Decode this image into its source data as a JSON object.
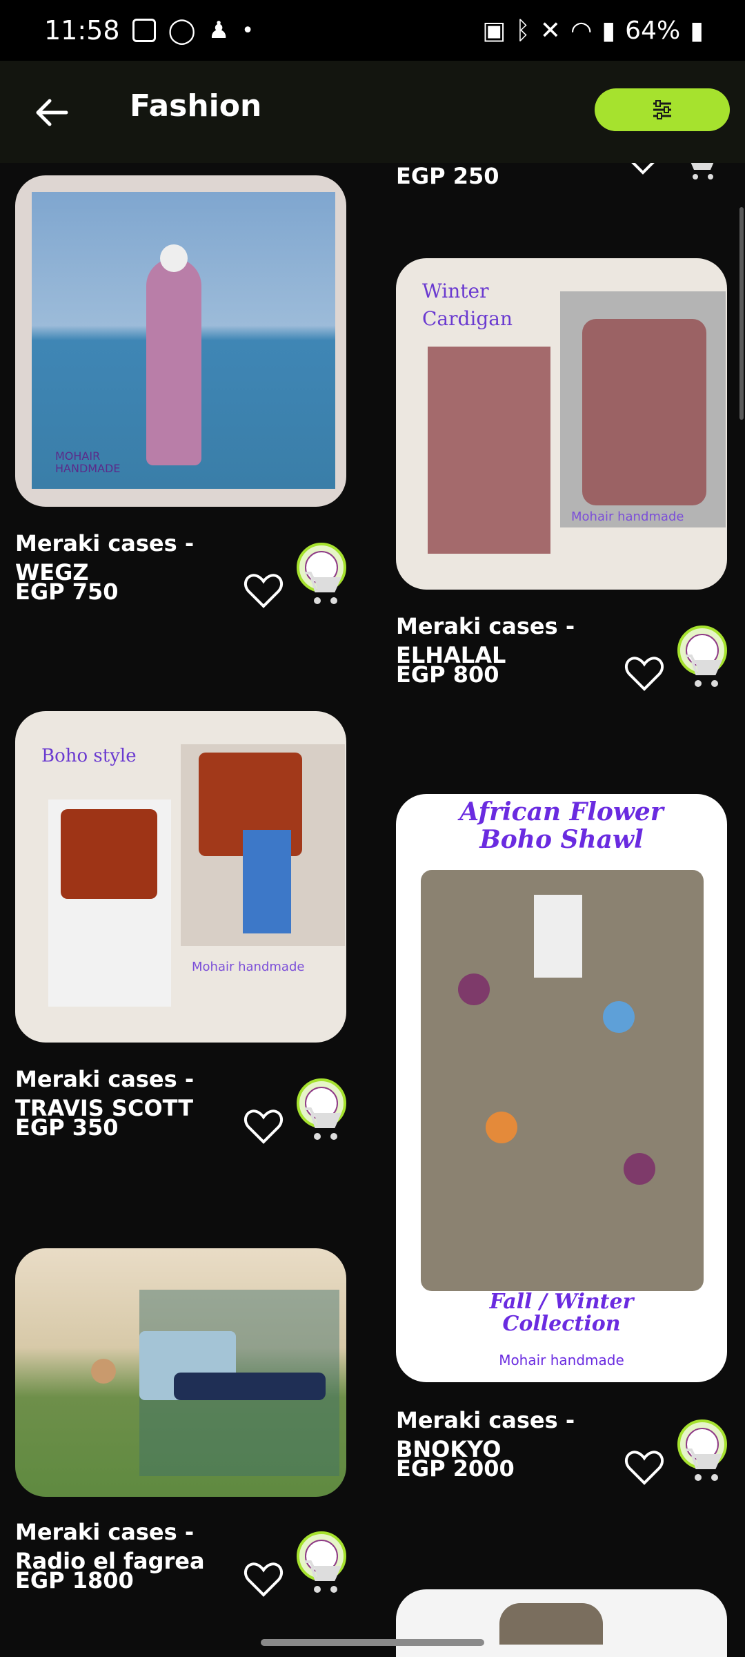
{
  "status_bar": {
    "time": "11:58",
    "battery": "64%"
  },
  "header": {
    "title": "Fashion"
  },
  "partial_top_right": {
    "price": "EGP 250"
  },
  "products": [
    {
      "name": "Meraki cases  -\nWEGZ",
      "price": "EGP 750",
      "img_text": [
        "MOHAIR",
        "HANDMADE"
      ]
    },
    {
      "name": "Meraki cases  -\nELHALAL",
      "price": "EGP 800",
      "img_text": [
        "Winter",
        "Cardigan",
        "Mohair handmade"
      ]
    },
    {
      "name": "Meraki cases  -\nTRAVIS SCOTT",
      "price": "EGP 350",
      "img_text": [
        "Boho style",
        "Mohair handmade"
      ]
    },
    {
      "name": "Meraki cases  -\nBNOKYO",
      "price": "EGP 2000",
      "img_text": [
        "African Flower",
        "Boho Shawl",
        "Fall / Winter",
        "Collection",
        "Mohair handmade"
      ]
    },
    {
      "name": "Meraki cases  -\nRadio el fagrea",
      "price": "EGP 1800",
      "img_text": []
    }
  ],
  "colors": {
    "accent": "#a6e22e",
    "background": "#0c0c0c",
    "appbar": "#13150f"
  }
}
